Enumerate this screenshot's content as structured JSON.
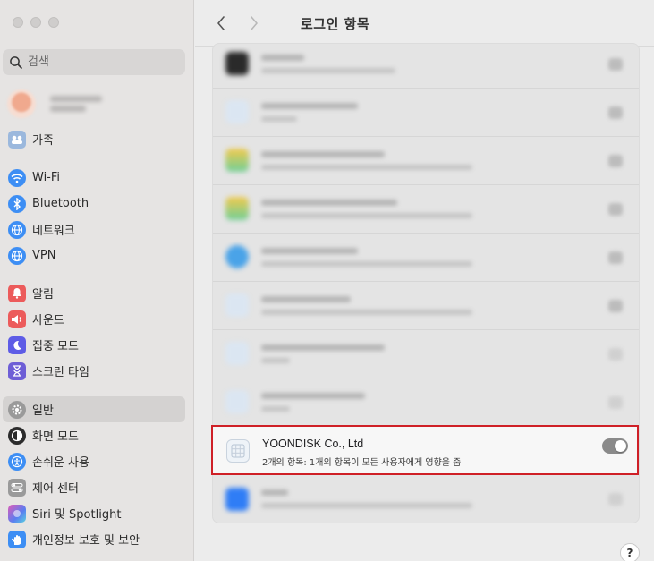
{
  "sidebar": {
    "search_placeholder": "검색",
    "items": [
      {
        "label": "가족",
        "icon": "family-icon"
      },
      {
        "label": "Wi-Fi",
        "icon": "wifi-icon"
      },
      {
        "label": "Bluetooth",
        "icon": "bluetooth-icon"
      },
      {
        "label": "네트워크",
        "icon": "network-globe-icon"
      },
      {
        "label": "VPN",
        "icon": "vpn-globe-icon"
      },
      {
        "label": "알림",
        "icon": "notifications-bell-icon"
      },
      {
        "label": "사운드",
        "icon": "sound-speaker-icon"
      },
      {
        "label": "집중 모드",
        "icon": "focus-moon-icon"
      },
      {
        "label": "스크린 타임",
        "icon": "hourglass-icon"
      },
      {
        "label": "일반",
        "icon": "gear-icon",
        "selected": true
      },
      {
        "label": "화면 모드",
        "icon": "appearance-icon"
      },
      {
        "label": "손쉬운 사용",
        "icon": "accessibility-icon"
      },
      {
        "label": "제어 센터",
        "icon": "control-center-icon"
      },
      {
        "label": "Siri 및 Spotlight",
        "icon": "siri-icon"
      },
      {
        "label": "개인정보 보호 및 보안",
        "icon": "hand-privacy-icon"
      }
    ]
  },
  "toolbar": {
    "title": "로그인 항목"
  },
  "highlighted_item": {
    "name": "YOONDISK Co., Ltd",
    "subtitle": "2개의 항목: 1개의 항목이 모든 사용자에게 영향을 줌",
    "toggle_on": true
  },
  "help_label": "?",
  "colors": {
    "highlight_border": "#cf2027",
    "sidebar_bg": "#e6e4e3",
    "selected_bg": "#d4d2d1"
  }
}
